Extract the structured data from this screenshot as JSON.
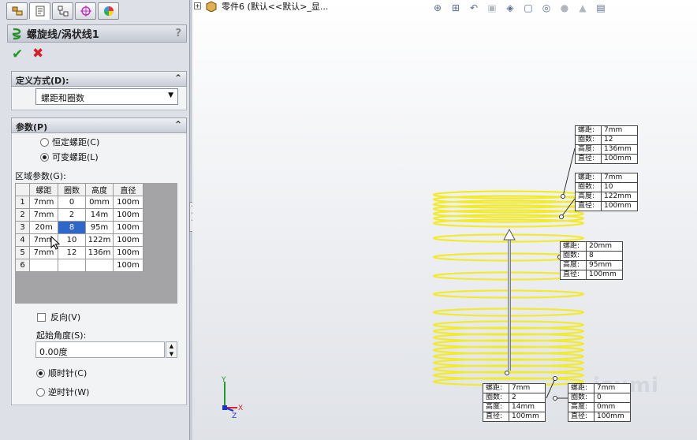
{
  "feature_manager": {
    "tabs": [
      "feature-tree-tab",
      "property-manager-tab",
      "configuration-tab",
      "dimxpert-tab",
      "display-tab"
    ]
  },
  "property_manager": {
    "title": "螺旋线/涡状线1",
    "help": "?",
    "definition": {
      "header": "定义方式(D):",
      "selected": "螺距和圈数"
    },
    "params": {
      "header": "参数(P)",
      "constant_pitch": "恒定螺距(C)",
      "variable_pitch": "可变螺距(L)",
      "region_label": "区域参数(G):",
      "columns": [
        "螺距",
        "圈数",
        "高度",
        "直径"
      ],
      "rows": [
        {
          "num": "1",
          "pitch": "7mm",
          "turns": "0",
          "height": "0mm",
          "diameter": "100m"
        },
        {
          "num": "2",
          "pitch": "7mm",
          "turns": "2",
          "height": "14m",
          "diameter": "100m"
        },
        {
          "num": "3",
          "pitch": "20m",
          "turns": "8",
          "height": "95m",
          "diameter": "100m"
        },
        {
          "num": "4",
          "pitch": "7mm",
          "turns": "10",
          "height": "122m",
          "diameter": "100m"
        },
        {
          "num": "5",
          "pitch": "7mm",
          "turns": "12",
          "height": "136m",
          "diameter": "100m"
        },
        {
          "num": "6",
          "pitch": "",
          "turns": "",
          "height": "",
          "diameter": "100m"
        }
      ],
      "reverse": "反向(V)",
      "start_angle_label": "起始角度(S):",
      "start_angle_value": "0.00度",
      "clockwise": "顺时针(C)",
      "counter_clockwise": "逆时针(W)"
    }
  },
  "viewport": {
    "tree_text": "零件6  (默认<<默认>_显...",
    "watermark": "isumi",
    "callouts": [
      {
        "id": "c12",
        "rows": [
          [
            "螺距:",
            "7mm"
          ],
          [
            "圈数:",
            "12"
          ],
          [
            "高度:",
            "136mm"
          ],
          [
            "直径:",
            "100mm"
          ]
        ]
      },
      {
        "id": "c10",
        "rows": [
          [
            "螺距:",
            "7mm"
          ],
          [
            "圈数:",
            "10"
          ],
          [
            "高度:",
            "122mm"
          ],
          [
            "直径:",
            "100mm"
          ]
        ]
      },
      {
        "id": "c8",
        "rows": [
          [
            "螺距:",
            "20mm"
          ],
          [
            "圈数:",
            "8"
          ],
          [
            "高度:",
            "95mm"
          ],
          [
            "直径:",
            "100mm"
          ]
        ]
      },
      {
        "id": "c2",
        "rows": [
          [
            "螺距:",
            "7mm"
          ],
          [
            "圈数:",
            "2"
          ],
          [
            "高度:",
            "14mm"
          ],
          [
            "直径:",
            "100mm"
          ]
        ]
      },
      {
        "id": "c0",
        "rows": [
          [
            "螺距:",
            "7mm"
          ],
          [
            "圈数:",
            "0"
          ],
          [
            "高度:",
            "0mm"
          ],
          [
            "直径:",
            "100mm"
          ]
        ]
      }
    ],
    "triad": {
      "x": "X",
      "y": "Y",
      "z": "Z"
    }
  },
  "colors": {
    "helix": "#f2ea2c",
    "accent": "#2e66c9",
    "ok": "#1f9a1f",
    "cancel": "#d4202a"
  }
}
